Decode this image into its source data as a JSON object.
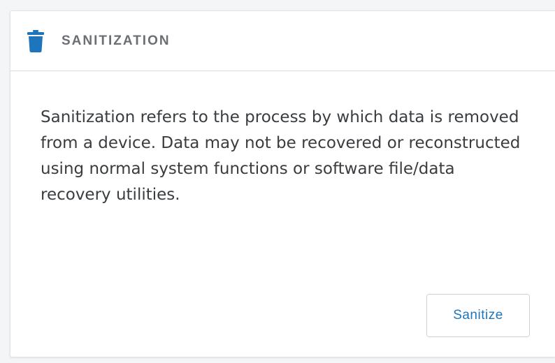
{
  "card": {
    "title": "SANITIZATION",
    "icon": "trash-icon",
    "description": "Sanitization refers to the process by which data is removed from a device. Data may not be recovered or reconstructed using normal system functions or software file/data recovery utilities.",
    "button_label": "Sanitize"
  },
  "colors": {
    "accent": "#1d76bd",
    "title_text": "#6b6f73",
    "body_text": "#3a3d40",
    "divider": "#d9dcdf"
  }
}
